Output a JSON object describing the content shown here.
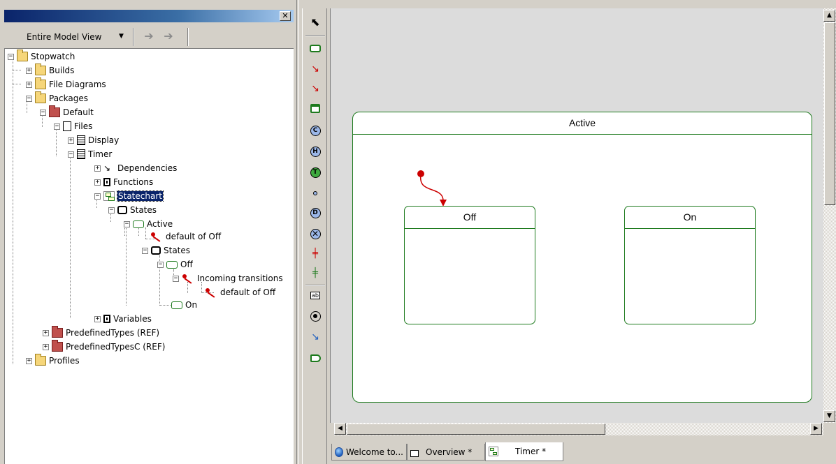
{
  "browser": {
    "close_glyph": "✕",
    "view_select": "Entire Model View",
    "tree": [
      {
        "id": "stopwatch",
        "label": "Stopwatch"
      },
      {
        "id": "builds",
        "label": "Builds"
      },
      {
        "id": "file_diagrams",
        "label": "File Diagrams"
      },
      {
        "id": "packages",
        "label": "Packages"
      },
      {
        "id": "default",
        "label": "Default"
      },
      {
        "id": "files",
        "label": "Files"
      },
      {
        "id": "display",
        "label": "Display"
      },
      {
        "id": "timer",
        "label": "Timer"
      },
      {
        "id": "dependencies",
        "label": "Dependencies"
      },
      {
        "id": "functions",
        "label": "Functions"
      },
      {
        "id": "statechart",
        "label": "Statechart"
      },
      {
        "id": "states",
        "label": "States"
      },
      {
        "id": "active",
        "label": "Active"
      },
      {
        "id": "default_of_off_1",
        "label": "default of Off"
      },
      {
        "id": "states2",
        "label": "States"
      },
      {
        "id": "off",
        "label": "Off"
      },
      {
        "id": "incoming",
        "label": "Incoming transitions"
      },
      {
        "id": "default_of_off_2",
        "label": "default of Off"
      },
      {
        "id": "on",
        "label": "On"
      },
      {
        "id": "variables",
        "label": "Variables"
      },
      {
        "id": "predefined",
        "label": "PredefinedTypes (REF)"
      },
      {
        "id": "predefinedc",
        "label": "PredefinedTypesC (REF)"
      },
      {
        "id": "profiles",
        "label": "Profiles"
      }
    ]
  },
  "palette": {
    "condition": "C",
    "history": "H",
    "termination": "T",
    "diagram_connector": "D",
    "text_tool": "ab"
  },
  "diagram": {
    "outer_state": "Active",
    "states": [
      "Off",
      "On"
    ]
  },
  "tabs": [
    {
      "label": "Welcome to...",
      "icon": "globe-icon"
    },
    {
      "label": "Overview *",
      "icon": "object-model-diagram-icon"
    },
    {
      "label": "Timer *",
      "icon": "statechart-icon",
      "active": true
    }
  ],
  "colors": {
    "state_border": "#1d7a1d",
    "transition": "#c00000",
    "selection": "#0a246a"
  }
}
